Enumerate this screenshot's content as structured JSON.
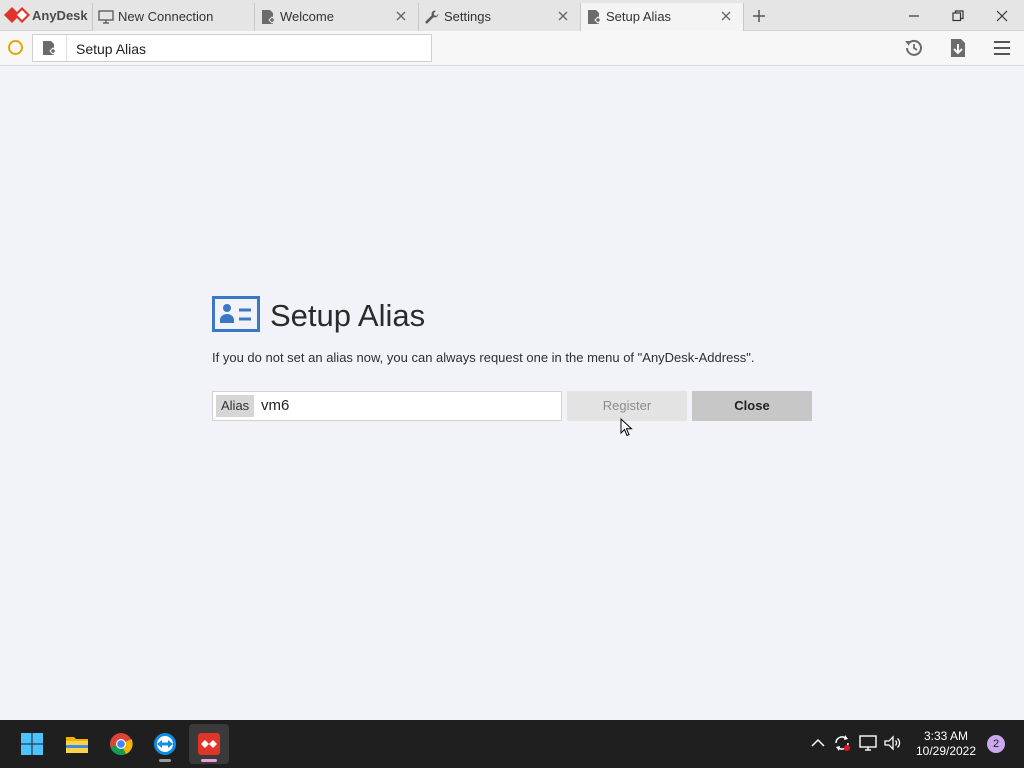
{
  "app": {
    "name": "AnyDesk"
  },
  "tabs": [
    {
      "label": "New Connection",
      "icon": "monitor-icon",
      "closable": false,
      "active": false
    },
    {
      "label": "Welcome",
      "icon": "anydesk-doc-icon",
      "closable": true,
      "active": false
    },
    {
      "label": "Settings",
      "icon": "wrench-icon",
      "closable": true,
      "active": false
    },
    {
      "label": "Setup Alias",
      "icon": "anydesk-doc-icon",
      "closable": true,
      "active": true
    }
  ],
  "address_bar": {
    "value": "Setup Alias",
    "status_color": "#e8a500"
  },
  "toolbar": {
    "icons": [
      "history-icon",
      "download-icon",
      "menu-icon"
    ]
  },
  "page": {
    "title": "Setup Alias",
    "description": "If you do not set an alias now, you can always request one in the menu of \"AnyDesk-Address\".",
    "alias_label": "Alias",
    "alias_value": "vm6",
    "register_label": "Register",
    "close_label": "Close"
  },
  "taskbar": {
    "apps": [
      "windows-start-icon",
      "file-explorer-icon",
      "chrome-icon",
      "teamviewer-icon",
      "anydesk-icon"
    ],
    "time": "3:33 AM",
    "date": "10/29/2022",
    "notification_count": "2"
  },
  "colors": {
    "accent": "#e0342a",
    "icon_blue": "#3b78c4"
  }
}
